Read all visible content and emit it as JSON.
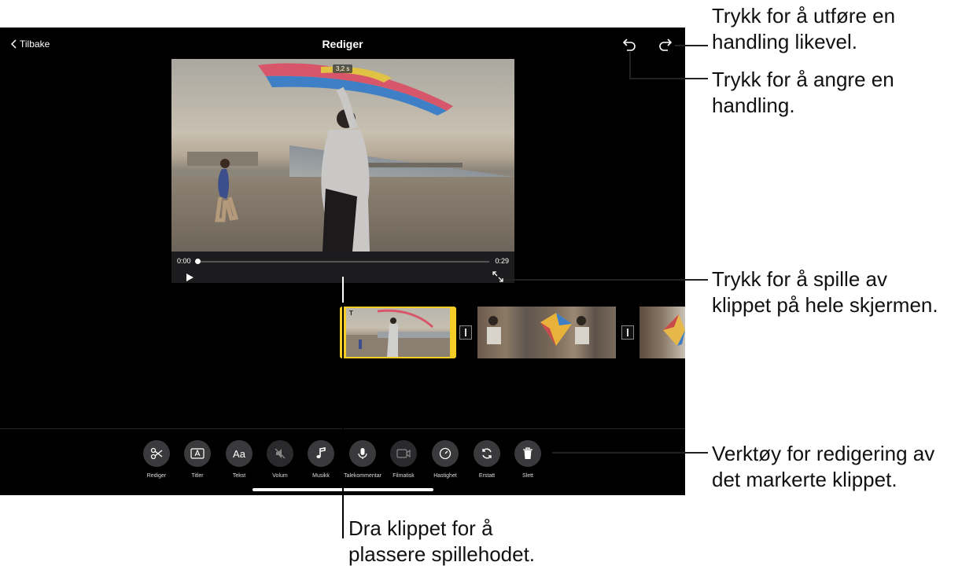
{
  "nav": {
    "back_label": "Tilbake",
    "title": "Rediger"
  },
  "viewer": {
    "clip_duration": "3,2 s",
    "time_start": "0:00",
    "time_end": "0:29"
  },
  "timeline": {
    "selected_clip_badge": "T"
  },
  "tools": [
    {
      "label": "Rediger",
      "icon": "scissors-icon"
    },
    {
      "label": "Titler",
      "icon": "titles-icon"
    },
    {
      "label": "Tekst",
      "icon": "text-icon",
      "glyph": "Aa"
    },
    {
      "label": "Volum",
      "icon": "volume-mute-icon"
    },
    {
      "label": "Musikk",
      "icon": "music-note-icon"
    },
    {
      "label": "Talekommentar",
      "icon": "microphone-icon"
    },
    {
      "label": "Filmatisk",
      "icon": "cinematic-camera-icon"
    },
    {
      "label": "Hastighet",
      "icon": "speedometer-icon"
    },
    {
      "label": "Erstatt",
      "icon": "replace-icon"
    },
    {
      "label": "Slett",
      "icon": "trash-icon"
    }
  ],
  "callouts": {
    "redo": [
      "Trykk for å utføre en",
      "handling likevel."
    ],
    "undo": [
      "Trykk for å angre en",
      "handling."
    ],
    "fullscreen": [
      "Trykk for å spille av",
      "klippet på hele skjermen."
    ],
    "tools": [
      "Verktøy for redigering av",
      "det markerte klippet."
    ],
    "playhead": [
      "Dra klippet for å",
      "plassere spillehodet."
    ]
  }
}
